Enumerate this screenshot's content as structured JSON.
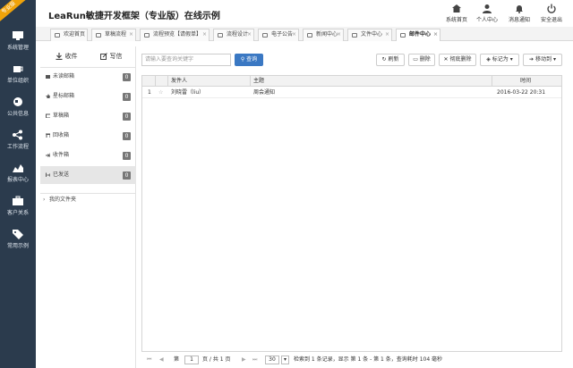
{
  "sidebar": {
    "badge": "专业版",
    "items": [
      {
        "icon": "monitor-icon",
        "label": "系统管理"
      },
      {
        "icon": "coffee-cup-icon",
        "label": "单位组织"
      },
      {
        "icon": "globe-icon",
        "label": "公共信息"
      },
      {
        "icon": "share-icon",
        "label": "工作流程"
      },
      {
        "icon": "area-chart-icon",
        "label": "报表中心"
      },
      {
        "icon": "briefcase-icon",
        "label": "客户关系"
      },
      {
        "icon": "tag-icon",
        "label": "常用示例"
      }
    ]
  },
  "header": {
    "title": "LeaRun敏捷开发框架（专业版）在线示例",
    "buttons": [
      {
        "icon": "home-icon",
        "label": "系统首页"
      },
      {
        "icon": "user-icon",
        "label": "个人中心"
      },
      {
        "icon": "bell-icon",
        "label": "消息通知"
      },
      {
        "icon": "power-icon",
        "label": "安全退出"
      }
    ]
  },
  "tabs": [
    {
      "label": "欢迎首页",
      "closable": false
    },
    {
      "label": "草稿流程",
      "closable": true
    },
    {
      "label": "流程预览【请假单】",
      "closable": true
    },
    {
      "label": "流程设计",
      "closable": true
    },
    {
      "label": "电子公告",
      "closable": true
    },
    {
      "label": "新闻中心",
      "closable": true
    },
    {
      "label": "文件中心",
      "closable": true
    },
    {
      "label": "邮件中心",
      "closable": true,
      "active": true
    }
  ],
  "mail": {
    "receive_label": "收件",
    "compose_label": "写信",
    "folders": [
      {
        "label": "未读邮箱",
        "count": "0",
        "icon": "inbox-icon"
      },
      {
        "label": "星标邮箱",
        "count": "0",
        "icon": "star-icon"
      },
      {
        "label": "草稿箱",
        "count": "0",
        "icon": "drafts-icon"
      },
      {
        "label": "回收箱",
        "count": "0",
        "icon": "trash-icon"
      },
      {
        "label": "收件箱",
        "count": "0",
        "icon": "mail-in-icon"
      },
      {
        "label": "已发送",
        "count": "0",
        "icon": "sent-icon",
        "selected": true
      }
    ],
    "my_folder": "我的文件夹"
  },
  "toolbar": {
    "search_placeholder": "请输入要查询关键字",
    "search_button": "查询",
    "refresh": "刷新",
    "delete": "删除",
    "purge": "彻底删除",
    "mark": "标记为",
    "move": "移动到"
  },
  "grid": {
    "columns": [
      "发件人",
      "主题",
      "时间"
    ],
    "rows": [
      {
        "num": "1",
        "sender": "刘晓雷（liu）",
        "subject": "周会通知",
        "time": "2016-03-22 20:31"
      }
    ]
  },
  "pager": {
    "page_label": "第",
    "page_value": "1",
    "page_total": "页 / 共 1 页",
    "page_size": "30",
    "summary": "检索到 1 条记录，显示 第 1 条 - 第 1 条，查询耗时 104 毫秒"
  },
  "colors": {
    "sidebar": "#2b3b4d",
    "badge": "#f0a30a",
    "primary": "#3a78c3"
  }
}
